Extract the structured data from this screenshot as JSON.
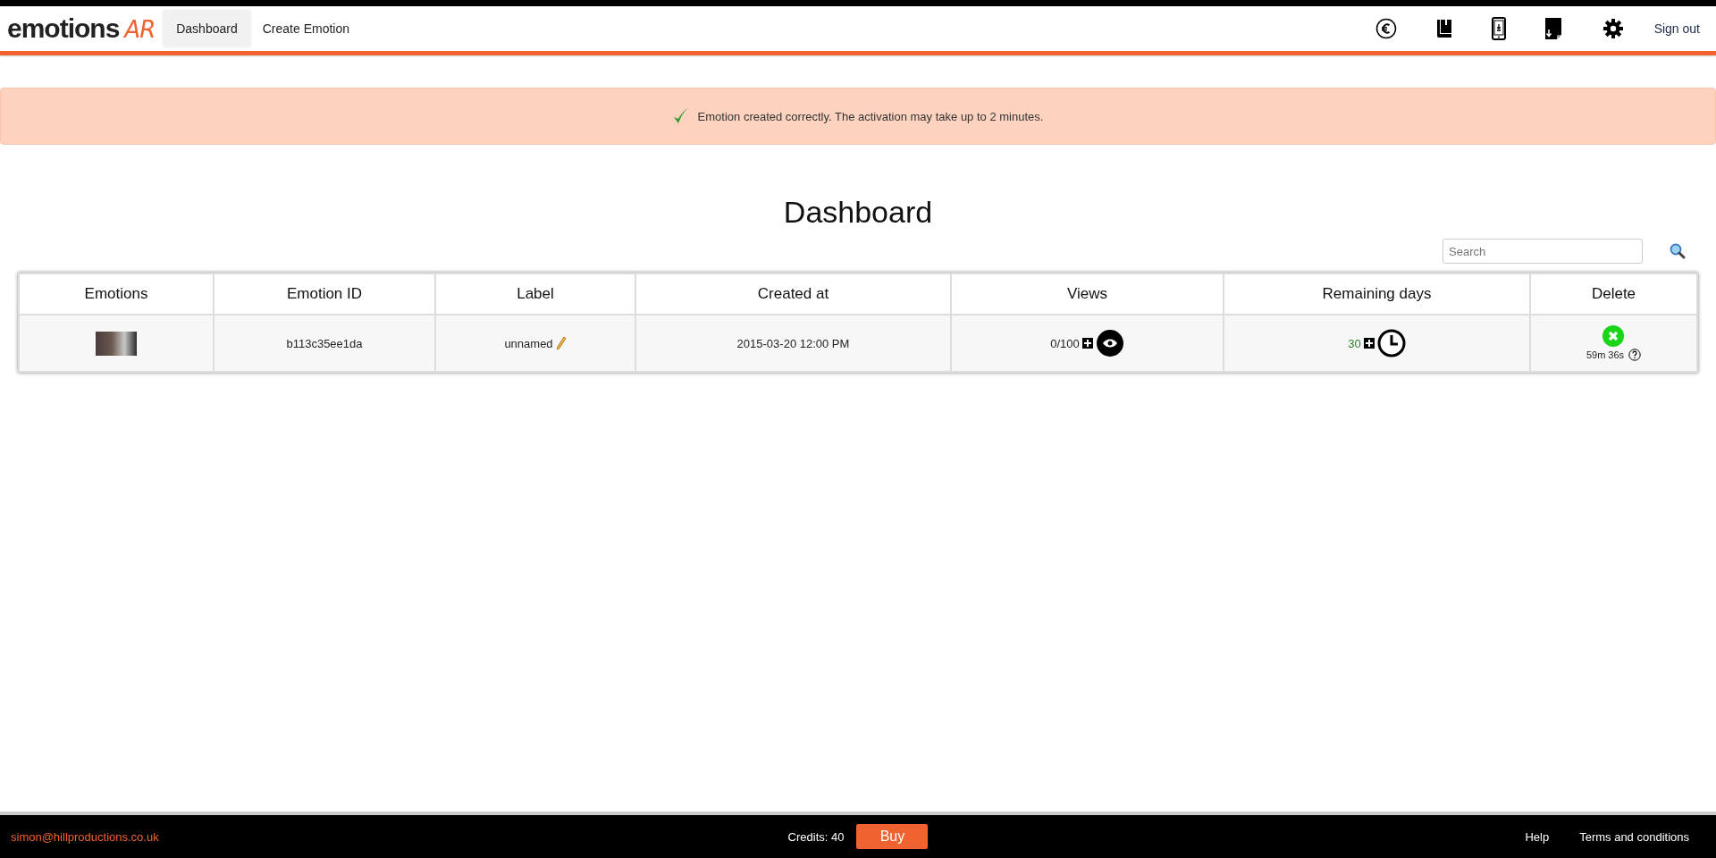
{
  "brand": {
    "name": "emotions",
    "suffix": "AR"
  },
  "tabs": [
    {
      "label": "Dashboard",
      "selected": true
    },
    {
      "label": "Create Emotion",
      "selected": false
    }
  ],
  "sign_out": "Sign out",
  "alert": {
    "message": "Emotion created correctly. The activation may take up to 2 minutes."
  },
  "page_title": "Dashboard",
  "search": {
    "placeholder": "Search"
  },
  "table": {
    "columns": [
      "Emotions",
      "Emotion ID",
      "Label",
      "Created at",
      "Views",
      "Remaining days",
      "Delete"
    ],
    "rows": [
      {
        "emotion_id": "b113c35ee1da",
        "label": "unnamed",
        "created_at": "2015-03-20 12:00 PM",
        "views": "0/100",
        "remaining_days": "30",
        "delete_timer": "59m 36s"
      }
    ]
  },
  "footer": {
    "email": "simon@hillproductions.co.uk",
    "credits": "Credits: 40",
    "buy": "Buy",
    "links": [
      "Help",
      "Terms and conditions"
    ]
  }
}
